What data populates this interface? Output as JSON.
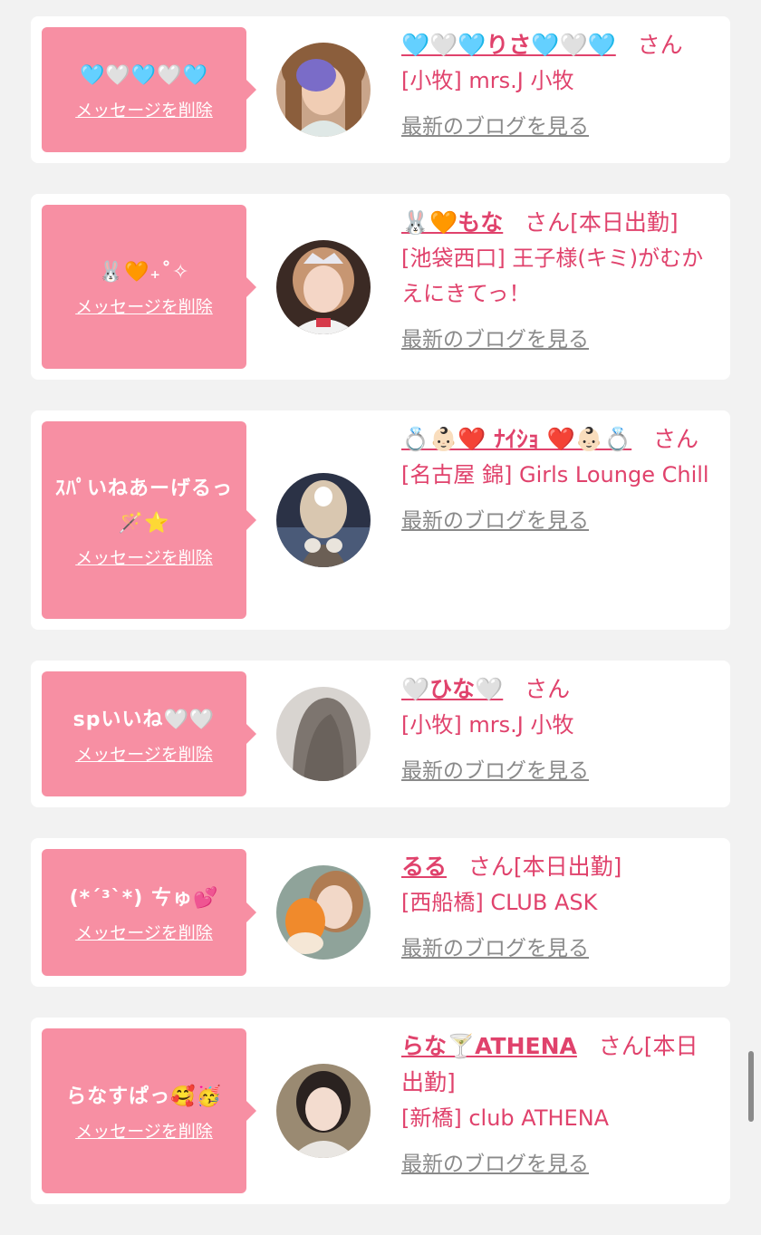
{
  "delete_label": "メッセージを削除",
  "blog_label": "最新のブログを見る",
  "san_label": "さん",
  "theme": {
    "bubble": "#f78fa3",
    "name": "#e0426c",
    "link": "#8a8a8a"
  },
  "items": [
    {
      "message": "🩵🤍🩵🤍🩵",
      "name": "🩵🤍🩵りさ🩵🤍🩵",
      "suffix": "",
      "shop": "[小牧] mrs.J 小牧",
      "avatar_icon": "profile-photo-icon"
    },
    {
      "message": "🐰🧡₊˚✧",
      "name": "🐰🧡もな",
      "suffix": "[本日出勤]",
      "shop": "[池袋西口] 王子様(キミ)がむかえにきてっ！",
      "avatar_icon": "profile-photo-icon"
    },
    {
      "message": "ｽﾊﾟいねあーげるっ🪄⭐️",
      "name": "💍👶🏻❤️ ﾅｲｼｮ ❤️👶🏻💍",
      "suffix": "",
      "shop": "[名古屋 錦] Girls Lounge Chill",
      "avatar_icon": "profile-photo-icon"
    },
    {
      "message": "spいいね🤍🤍",
      "name": "🤍ひな🤍",
      "suffix": "",
      "shop": "[小牧] mrs.J 小牧",
      "avatar_icon": "profile-photo-icon"
    },
    {
      "message": "(*´³`*) ㄘゅ💕",
      "name": "るる",
      "suffix": "[本日出勤]",
      "shop": "[西船橋] CLUB ASK",
      "avatar_icon": "profile-photo-icon"
    },
    {
      "message": "らなすぱっ🥰🥳",
      "name": "らな🍸ATHENA",
      "suffix": "[本日出勤]",
      "shop": "[新橋] club ATHENA",
      "avatar_icon": "profile-photo-icon"
    }
  ]
}
